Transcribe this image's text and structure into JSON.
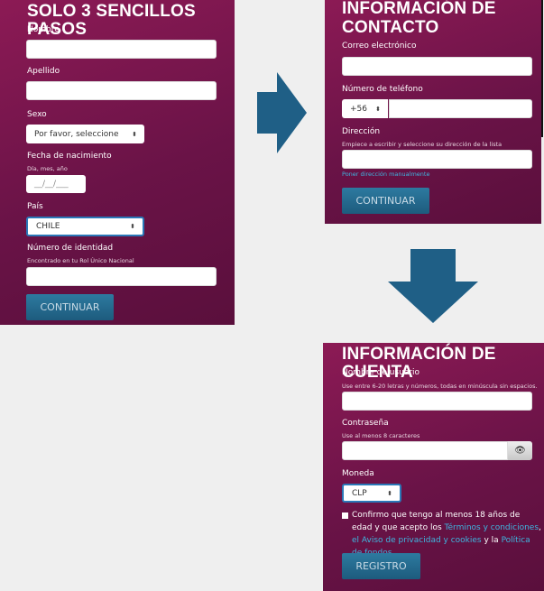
{
  "step1": {
    "title": "SOLO 3 SENCILLOS PASOS",
    "nombre_label": "Nombre",
    "apellido_label": "Apellido",
    "sexo_label": "Sexo",
    "sexo_value": "Por favor, seleccione",
    "fecha_label": "Fecha de nacimiento",
    "fecha_hint": "Día, mes, año",
    "fecha_placeholder": "__/__/___",
    "pais_label": "País",
    "pais_value": "CHILE",
    "identidad_label": "Número de identidad",
    "identidad_hint": "Encontrado en tu Rol Único Nacional",
    "continue_label": "CONTINUAR"
  },
  "step2": {
    "title_line1": "INFORMACIÓN DE",
    "title_line2": "CONTACTO",
    "email_label": "Correo electrónico",
    "phone_label": "Número de teléfono",
    "phone_code": "+56",
    "address_label": "Dirección",
    "address_hint": "Empiece a escribir y seleccione su dirección de la lista",
    "manual_link": "Poner dirección manualmente",
    "continue_label": "CONTINUAR"
  },
  "step3": {
    "title": "INFORMACIÓN DE CUENTA",
    "username_label": "Nombre de usuario",
    "username_hint": "Use entre 6-20 letras y números, todas en minúscula sin espacios.",
    "password_label": "Contraseña",
    "password_hint": "Use al menos 8 caracteres",
    "currency_label": "Moneda",
    "currency_value": "CLP",
    "terms_text1": "Confirmo que tengo al menos 18 años de edad y que acepto los ",
    "terms_link1": "Términos y condiciones",
    "terms_sep": ", ",
    "terms_link2": "el Aviso de privacidad y cookies",
    "terms_text2": " y la ",
    "terms_link3": "Política de fondos",
    "terms_end": ".",
    "register_label": "REGISTRO"
  },
  "colors": {
    "panel": "#6a1347",
    "button": "#1d5b7d",
    "arrow": "#1f5f86",
    "link": "#3eb6e0"
  }
}
